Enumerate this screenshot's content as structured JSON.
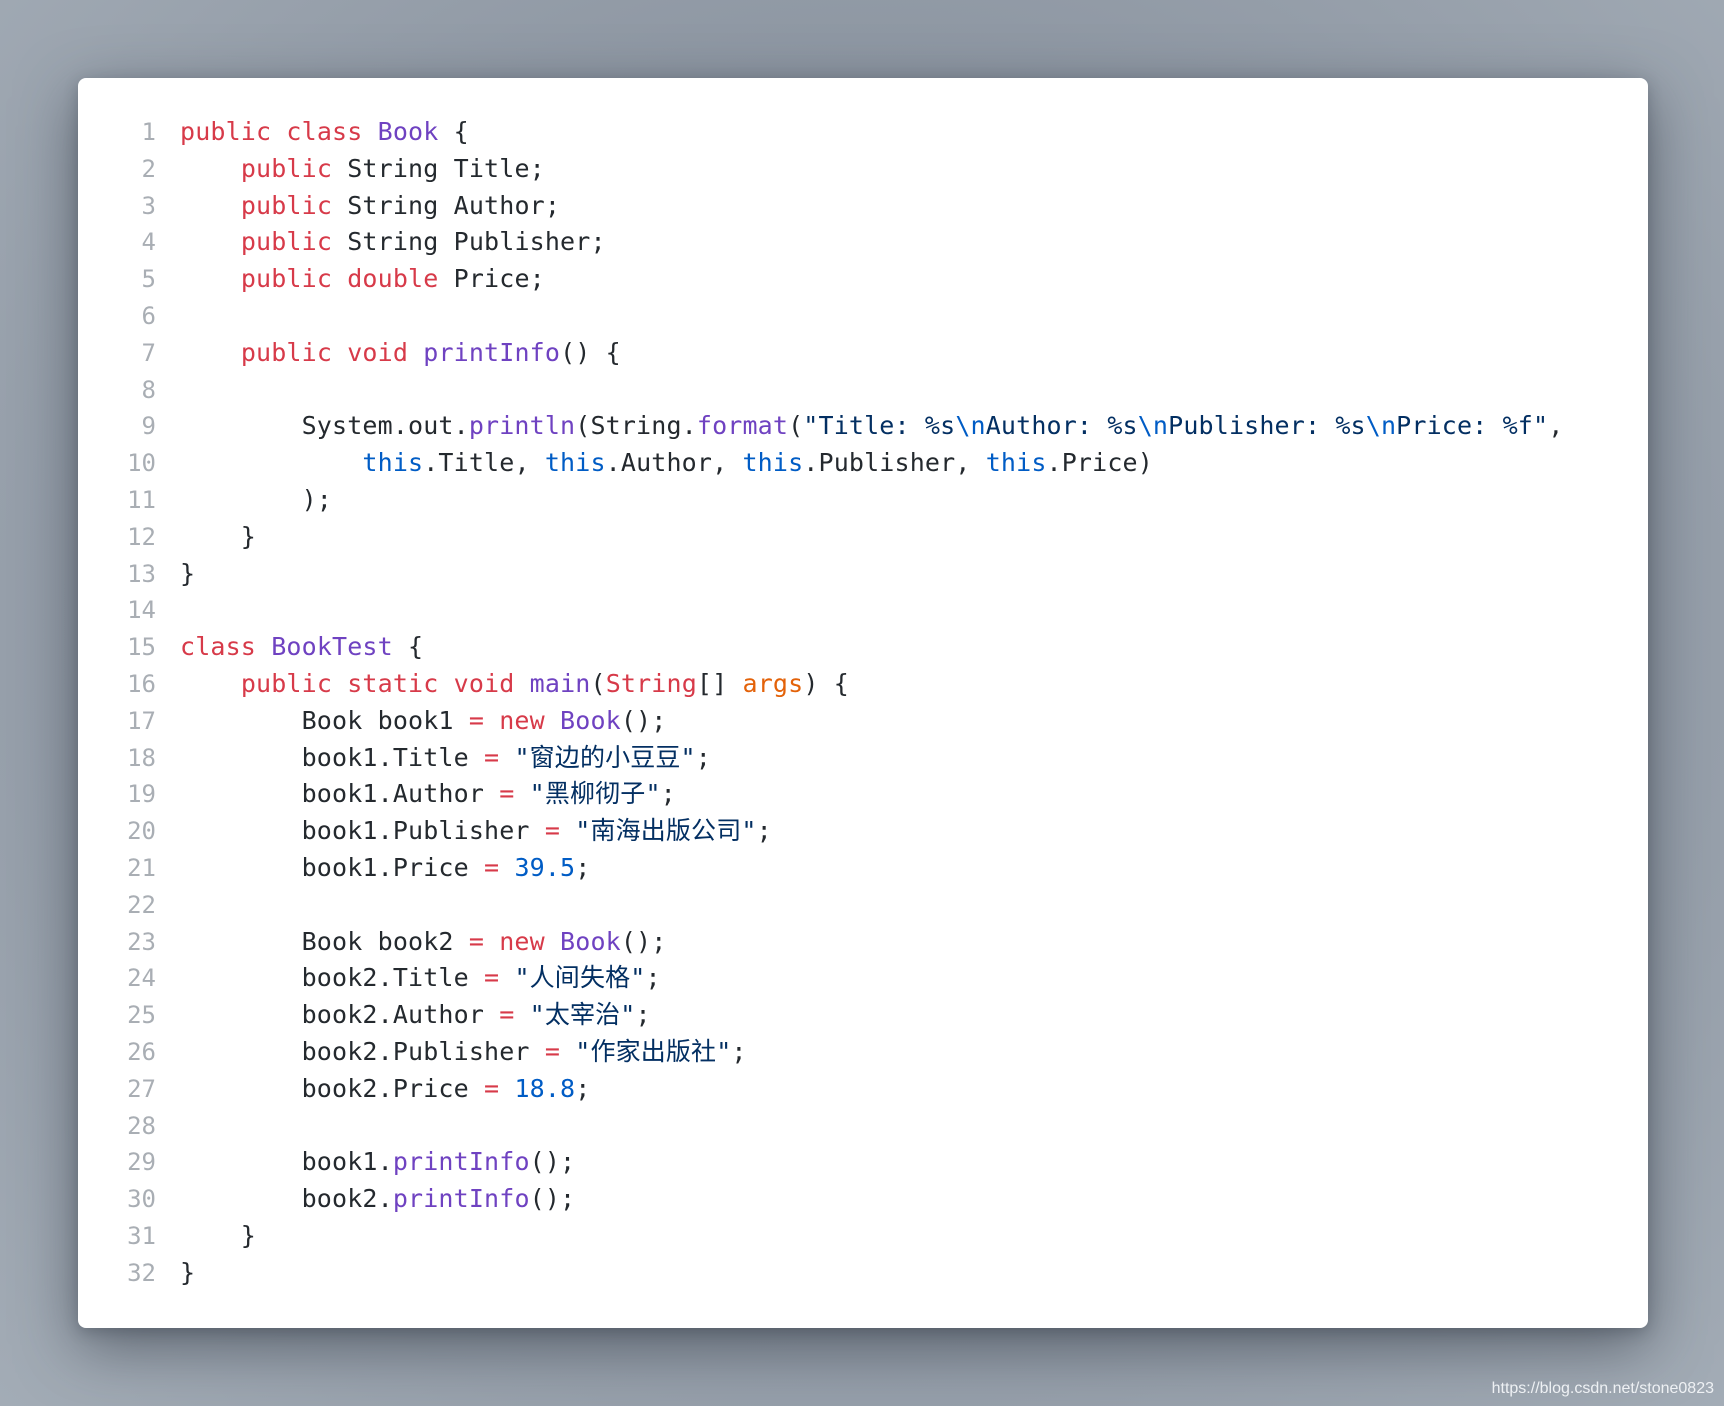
{
  "code_lines": [
    {
      "n": "1",
      "tokens": [
        [
          "kw",
          "public"
        ],
        [
          "plain",
          " "
        ],
        [
          "kw",
          "class"
        ],
        [
          "plain",
          " "
        ],
        [
          "cls",
          "Book"
        ],
        [
          "plain",
          " {"
        ]
      ]
    },
    {
      "n": "2",
      "tokens": [
        [
          "plain",
          "    "
        ],
        [
          "kw",
          "public"
        ],
        [
          "plain",
          " String Title;"
        ]
      ]
    },
    {
      "n": "3",
      "tokens": [
        [
          "plain",
          "    "
        ],
        [
          "kw",
          "public"
        ],
        [
          "plain",
          " String Author;"
        ]
      ]
    },
    {
      "n": "4",
      "tokens": [
        [
          "plain",
          "    "
        ],
        [
          "kw",
          "public"
        ],
        [
          "plain",
          " String Publisher;"
        ]
      ]
    },
    {
      "n": "5",
      "tokens": [
        [
          "plain",
          "    "
        ],
        [
          "kw",
          "public"
        ],
        [
          "plain",
          " "
        ],
        [
          "kw",
          "double"
        ],
        [
          "plain",
          " Price;"
        ]
      ]
    },
    {
      "n": "6",
      "tokens": []
    },
    {
      "n": "7",
      "tokens": [
        [
          "plain",
          "    "
        ],
        [
          "kw",
          "public"
        ],
        [
          "plain",
          " "
        ],
        [
          "kw",
          "void"
        ],
        [
          "plain",
          " "
        ],
        [
          "fn",
          "printInfo"
        ],
        [
          "plain",
          "() {"
        ]
      ]
    },
    {
      "n": "8",
      "tokens": []
    },
    {
      "n": "9",
      "tokens": [
        [
          "plain",
          "        System.out."
        ],
        [
          "fn",
          "println"
        ],
        [
          "plain",
          "(String."
        ],
        [
          "fn",
          "format"
        ],
        [
          "plain",
          "("
        ],
        [
          "str",
          "\"Title: %s"
        ],
        [
          "esc",
          "\\n"
        ],
        [
          "str",
          "Author: %s"
        ],
        [
          "esc",
          "\\n"
        ],
        [
          "str",
          "Publisher: %s"
        ],
        [
          "esc",
          "\\n"
        ],
        [
          "str",
          "Price: %f\""
        ],
        [
          "plain",
          ","
        ]
      ]
    },
    {
      "n": "10",
      "tokens": [
        [
          "plain",
          "            "
        ],
        [
          "this",
          "this"
        ],
        [
          "plain",
          ".Title, "
        ],
        [
          "this",
          "this"
        ],
        [
          "plain",
          ".Author, "
        ],
        [
          "this",
          "this"
        ],
        [
          "plain",
          ".Publisher, "
        ],
        [
          "this",
          "this"
        ],
        [
          "plain",
          ".Price)"
        ]
      ]
    },
    {
      "n": "11",
      "tokens": [
        [
          "plain",
          "        );"
        ]
      ]
    },
    {
      "n": "12",
      "tokens": [
        [
          "plain",
          "    }"
        ]
      ]
    },
    {
      "n": "13",
      "tokens": [
        [
          "plain",
          "}"
        ]
      ]
    },
    {
      "n": "14",
      "tokens": []
    },
    {
      "n": "15",
      "tokens": [
        [
          "kw",
          "class"
        ],
        [
          "plain",
          " "
        ],
        [
          "cls",
          "BookTest"
        ],
        [
          "plain",
          " {"
        ]
      ]
    },
    {
      "n": "16",
      "tokens": [
        [
          "plain",
          "    "
        ],
        [
          "kw",
          "public"
        ],
        [
          "plain",
          " "
        ],
        [
          "kw",
          "static"
        ],
        [
          "plain",
          " "
        ],
        [
          "kw",
          "void"
        ],
        [
          "plain",
          " "
        ],
        [
          "fn",
          "main"
        ],
        [
          "plain",
          "("
        ],
        [
          "kw",
          "String"
        ],
        [
          "plain",
          "[] "
        ],
        [
          "param",
          "args"
        ],
        [
          "plain",
          ") {"
        ]
      ]
    },
    {
      "n": "17",
      "tokens": [
        [
          "plain",
          "        Book book1 "
        ],
        [
          "op",
          "="
        ],
        [
          "plain",
          " "
        ],
        [
          "kw",
          "new"
        ],
        [
          "plain",
          " "
        ],
        [
          "cls",
          "Book"
        ],
        [
          "plain",
          "();"
        ]
      ]
    },
    {
      "n": "18",
      "tokens": [
        [
          "plain",
          "        book1.Title "
        ],
        [
          "op",
          "="
        ],
        [
          "plain",
          " "
        ],
        [
          "str",
          "\"窗边的小豆豆\""
        ],
        [
          "plain",
          ";"
        ]
      ]
    },
    {
      "n": "19",
      "tokens": [
        [
          "plain",
          "        book1.Author "
        ],
        [
          "op",
          "="
        ],
        [
          "plain",
          " "
        ],
        [
          "str",
          "\"黑柳彻子\""
        ],
        [
          "plain",
          ";"
        ]
      ]
    },
    {
      "n": "20",
      "tokens": [
        [
          "plain",
          "        book1.Publisher "
        ],
        [
          "op",
          "="
        ],
        [
          "plain",
          " "
        ],
        [
          "str",
          "\"南海出版公司\""
        ],
        [
          "plain",
          ";"
        ]
      ]
    },
    {
      "n": "21",
      "tokens": [
        [
          "plain",
          "        book1.Price "
        ],
        [
          "op",
          "="
        ],
        [
          "plain",
          " "
        ],
        [
          "num",
          "39.5"
        ],
        [
          "plain",
          ";"
        ]
      ]
    },
    {
      "n": "22",
      "tokens": []
    },
    {
      "n": "23",
      "tokens": [
        [
          "plain",
          "        Book book2 "
        ],
        [
          "op",
          "="
        ],
        [
          "plain",
          " "
        ],
        [
          "kw",
          "new"
        ],
        [
          "plain",
          " "
        ],
        [
          "cls",
          "Book"
        ],
        [
          "plain",
          "();"
        ]
      ]
    },
    {
      "n": "24",
      "tokens": [
        [
          "plain",
          "        book2.Title "
        ],
        [
          "op",
          "="
        ],
        [
          "plain",
          " "
        ],
        [
          "str",
          "\"人间失格\""
        ],
        [
          "plain",
          ";"
        ]
      ]
    },
    {
      "n": "25",
      "tokens": [
        [
          "plain",
          "        book2.Author "
        ],
        [
          "op",
          "="
        ],
        [
          "plain",
          " "
        ],
        [
          "str",
          "\"太宰治\""
        ],
        [
          "plain",
          ";"
        ]
      ]
    },
    {
      "n": "26",
      "tokens": [
        [
          "plain",
          "        book2.Publisher "
        ],
        [
          "op",
          "="
        ],
        [
          "plain",
          " "
        ],
        [
          "str",
          "\"作家出版社\""
        ],
        [
          "plain",
          ";"
        ]
      ]
    },
    {
      "n": "27",
      "tokens": [
        [
          "plain",
          "        book2.Price "
        ],
        [
          "op",
          "="
        ],
        [
          "plain",
          " "
        ],
        [
          "num",
          "18.8"
        ],
        [
          "plain",
          ";"
        ]
      ]
    },
    {
      "n": "28",
      "tokens": []
    },
    {
      "n": "29",
      "tokens": [
        [
          "plain",
          "        book1."
        ],
        [
          "fn",
          "printInfo"
        ],
        [
          "plain",
          "();"
        ]
      ]
    },
    {
      "n": "30",
      "tokens": [
        [
          "plain",
          "        book2."
        ],
        [
          "fn",
          "printInfo"
        ],
        [
          "plain",
          "();"
        ]
      ]
    },
    {
      "n": "31",
      "tokens": [
        [
          "plain",
          "    }"
        ]
      ]
    },
    {
      "n": "32",
      "tokens": [
        [
          "plain",
          "}"
        ]
      ]
    }
  ],
  "syntax_colors": {
    "kw": "#d73a49",
    "cls": "#6f42c1",
    "fn": "#6f42c1",
    "str": "#032f62",
    "num": "#005cc5",
    "this": "#005cc5",
    "esc": "#005cc5",
    "param": "#e36209",
    "op": "#d73a49",
    "plain": "#24292e",
    "line_number": "#a9aeb4"
  },
  "watermark": "https://blog.csdn.net/stone0823"
}
